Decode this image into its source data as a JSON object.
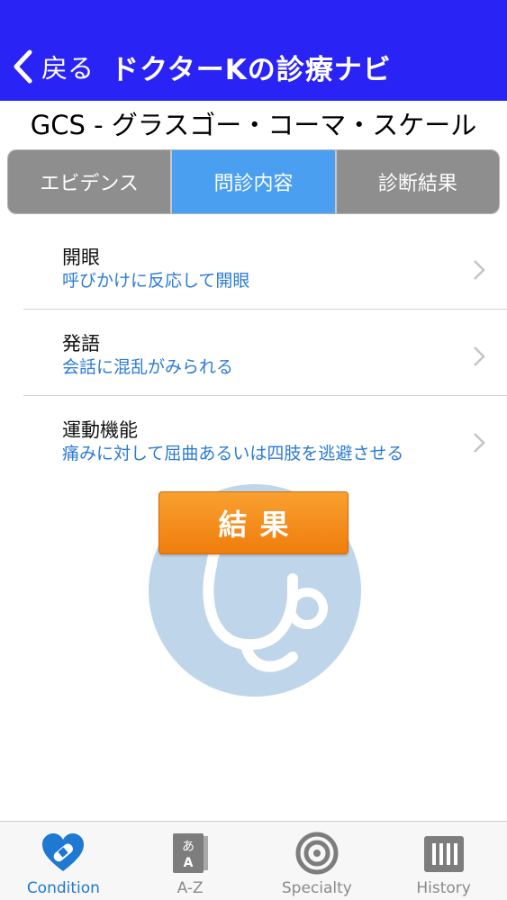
{
  "nav": {
    "back_label": "戻る",
    "title": "ドクターKの診療ナビ"
  },
  "page_title": "GCS - グラスゴー・コーマ・スケール",
  "segments": [
    {
      "label": "エビデンス",
      "active": false
    },
    {
      "label": "問診内容",
      "active": true
    },
    {
      "label": "診断結果",
      "active": false
    }
  ],
  "items": [
    {
      "title": "開眼",
      "value": "呼びかけに反応して開眼"
    },
    {
      "title": "発語",
      "value": "会話に混乱がみられる"
    },
    {
      "title": "運動機能",
      "value": "痛みに対して屈曲あるいは四肢を逃避させる"
    }
  ],
  "result_button": "結果",
  "tabs": [
    {
      "label": "Condition",
      "icon": "heart-bandage-icon",
      "active": true
    },
    {
      "label": "A-Z",
      "icon": "dictionary-icon",
      "active": false
    },
    {
      "label": "Specialty",
      "icon": "target-icon",
      "active": false
    },
    {
      "label": "History",
      "icon": "scroll-icon",
      "active": false
    }
  ],
  "colors": {
    "navbar": "#2a23f5",
    "segment_active": "#4a9ff0",
    "segment_inactive": "#8e8e8e",
    "result_button": "#f39118",
    "value_text": "#2c7bd4",
    "tab_active": "#1f78d1"
  }
}
